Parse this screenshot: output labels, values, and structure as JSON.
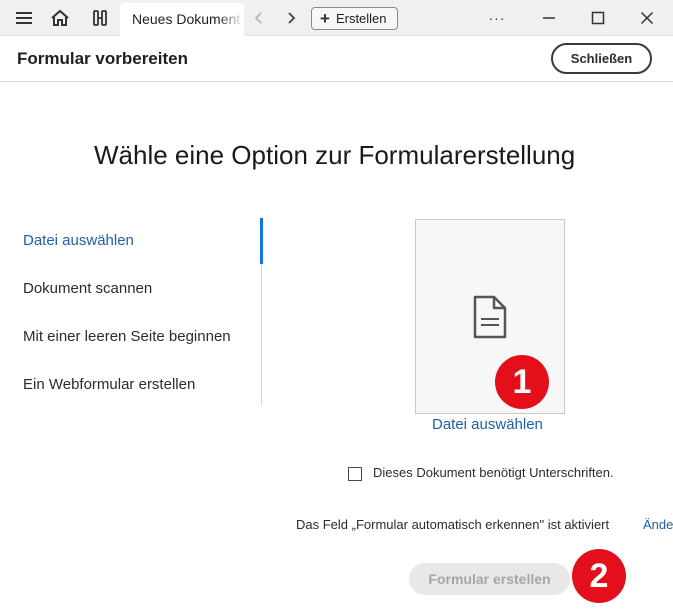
{
  "tab": {
    "label": "Neues Dokument"
  },
  "toolbar": {
    "create_label": "Erstellen",
    "more_label": "···"
  },
  "header": {
    "title": "Formular vorbereiten",
    "close_label": "Schließen"
  },
  "main": {
    "heading": "Wähle eine Option zur Formularerstellung",
    "options": [
      {
        "label": "Datei auswählen",
        "active": true
      },
      {
        "label": "Dokument scannen",
        "active": false
      },
      {
        "label": "Mit einer leeren Seite beginnen",
        "active": false
      },
      {
        "label": "Ein Webformular erstellen",
        "active": false
      }
    ],
    "tile_label": "Datei auswählen",
    "signature_checkbox": {
      "label": "Dieses Dokument benötigt Unterschriften.",
      "checked": false
    },
    "auto_detect_text": "Das Feld „Formular automatisch erkennen\" ist aktiviert",
    "auto_detect_link": "Ände",
    "submit_label": "Formular erstellen"
  },
  "annotations": {
    "badge_1": "1",
    "badge_2": "2"
  },
  "colors": {
    "accent": "#1473e6",
    "link": "#1f5fa6",
    "badge": "#e3101c"
  },
  "icons": [
    "menu-icon",
    "home-icon",
    "tools-icon",
    "chevron-left-icon",
    "chevron-right-icon",
    "plus-icon",
    "more-icon",
    "minimize-icon",
    "maximize-icon",
    "close-icon",
    "document-icon"
  ]
}
